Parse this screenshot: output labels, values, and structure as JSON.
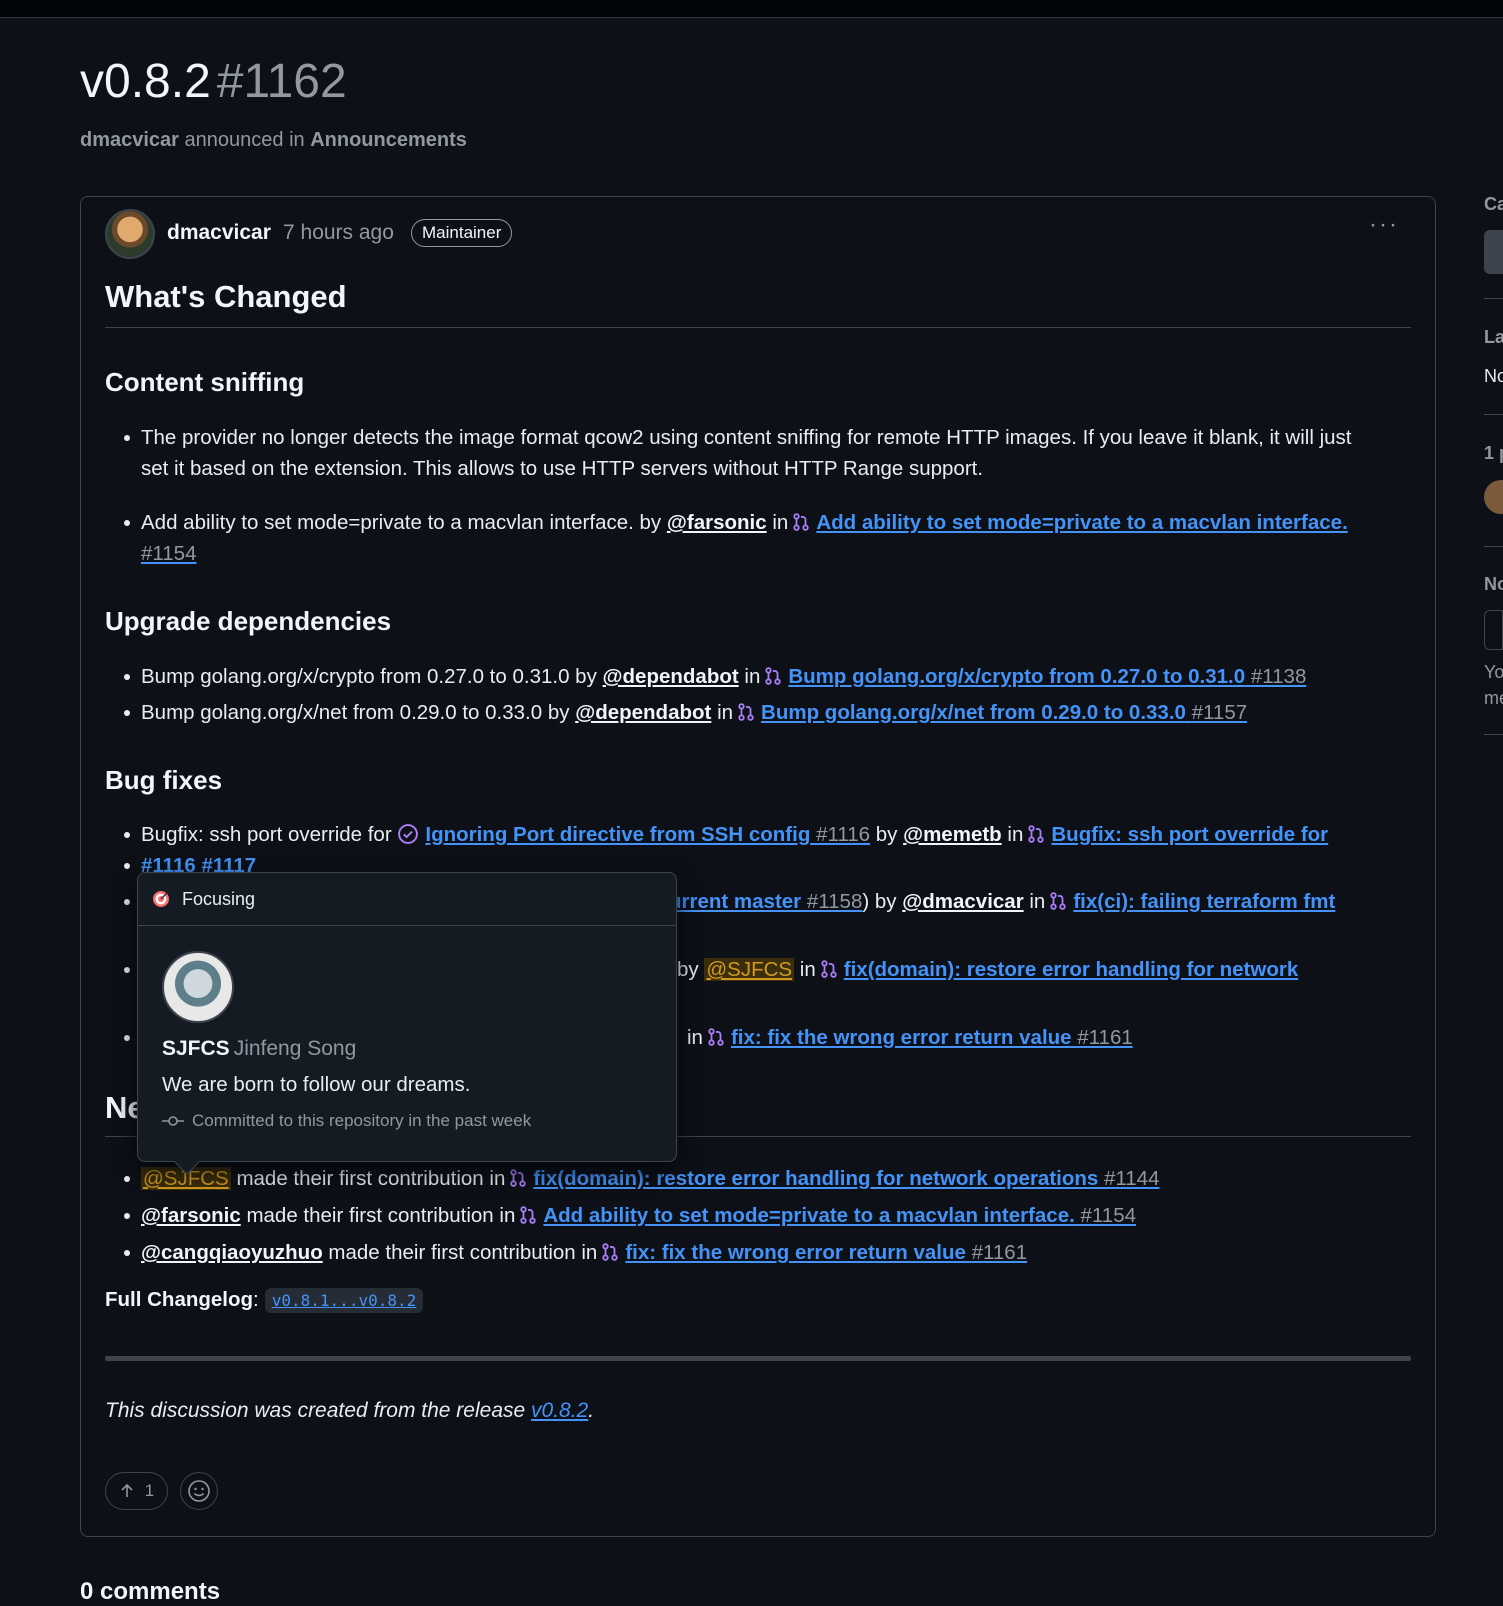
{
  "header": {
    "title": "v0.8.2",
    "number": "#1162",
    "author": "dmacvicar",
    "announced_in": "announced in",
    "category": "Announcements"
  },
  "post": {
    "author": "dmacvicar",
    "time": "7 hours ago",
    "badge": "Maintainer",
    "heading": "What's Changed",
    "sections": {
      "content_sniffing": "Content sniffing",
      "upgrade": "Upgrade dependencies",
      "bugfixes": "Bug fixes",
      "new_contrib": "Ne"
    },
    "items": {
      "cs1": "The provider no longer detects the image format qcow2 using content sniffing for remote HTTP images. If you leave it blank, it will just set it based on the extension. This allows to use HTTP servers without HTTP Range support.",
      "cs2_text": "Add ability to set mode=private to a macvlan interface. by",
      "cs2_mention": "@farsonic",
      "in": "in",
      "by": "by",
      "cs2_link": "Add ability to set mode=private to a macvlan interface.",
      "cs2_num": "#1154",
      "up1_text": "Bump golang.org/x/crypto from 0.27.0 to 0.31.0 by",
      "up1_mention": "@dependabot",
      "up1_link": "Bump golang.org/x/crypto from 0.27.0 to 0.31.0",
      "up1_num": "#1138",
      "up2_text": "Bump golang.org/x/net from 0.29.0 to 0.33.0 by",
      "up2_mention": "@dependabot",
      "up2_link": "Bump golang.org/x/net from 0.29.0 to 0.33.0",
      "up2_num": "#1157",
      "bf1_text": "Bugfix: ssh port override for",
      "bf1_issue": "Ignoring Port directive from SSH config",
      "bf1_issue_num": "#1116",
      "bf1_mention": "@memetb",
      "bf1_link": "Bugfix: ssh port override for",
      "bf1_cont": "#1116 #1117",
      "bf2_link_tail": "urrent master",
      "bf2_num": "#1158",
      "bf2_close": ")",
      "bf2_mention": "@dmacvicar",
      "bf2_link": "fix(ci): failing terraform fmt",
      "bf3_mention": "@SJFCS",
      "bf3_link": "fix(domain): restore error handling for network",
      "bf4_link": "fix: fix the wrong error return value",
      "bf4_num": "#1161",
      "nc1_mention": "@SJFCS",
      "nc_text": "made their first contribution in",
      "nc1_link": "fix(domain): restore error handling for network operations",
      "nc1_num": "#1144",
      "nc2_mention": "@farsonic",
      "nc2_link": "Add ability to set mode=private to a macvlan interface.",
      "nc2_num": "#1154",
      "nc3_mention": "@cangqiaoyuzhuo",
      "nc3_link": "fix: fix the wrong error return value",
      "nc3_num": "#1161"
    },
    "full_changelog_label": "Full Changelog",
    "full_changelog_link": "v0.8.1...v0.8.2",
    "footer_text": "This discussion was created from the release",
    "footer_link": "v0.8.2",
    "upvotes": "1"
  },
  "hovercard": {
    "status": "Focusing",
    "login": "SJFCS",
    "name": "Jinfeng Song",
    "bio": "We are born to follow our dreams.",
    "activity": "Committed to this repository in the past week"
  },
  "sidebar": {
    "c1": "Ca",
    "c2": "La",
    "c3": "No",
    "c4": "1 p",
    "c5": "No",
    "c6": "Yo",
    "c7": "me"
  },
  "comments_heading": "0 comments",
  "colors": {
    "background": "#0d1117",
    "link": "#4493f8",
    "pr_icon": "#ab7df8",
    "mention_highlight": "#d29922"
  },
  "icons": [
    "pull-request-icon",
    "issue-closed-icon",
    "kebab-icon",
    "arrow-up-icon",
    "smiley-icon",
    "target-icon",
    "commit-icon"
  ]
}
